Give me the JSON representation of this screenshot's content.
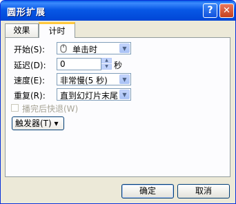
{
  "window": {
    "title": "圆形扩展",
    "help_symbol": "?",
    "close_symbol": "✕"
  },
  "tabs": [
    {
      "label": "效果"
    },
    {
      "label": "计时"
    }
  ],
  "timing": {
    "start_label": "开始(S):",
    "start_value": "单击时",
    "delay_label": "延迟(D):",
    "delay_value": "0",
    "delay_unit": "秒",
    "speed_label": "速度(E):",
    "speed_value": "非常慢(5 秒)",
    "repeat_label": "重复(R):",
    "repeat_value": "直到幻灯片末尾",
    "rewind_label": "播完后快退(W)",
    "trigger_label": "触发器(T) ▾"
  },
  "footer": {
    "ok_label": "确定",
    "cancel_label": "取消"
  },
  "icons": {
    "start": "mouse-icon"
  },
  "colors": {
    "title_bar": "#0858e6",
    "dialog_bg": "#ece9d8",
    "tab_accent": "#ffc83c"
  }
}
